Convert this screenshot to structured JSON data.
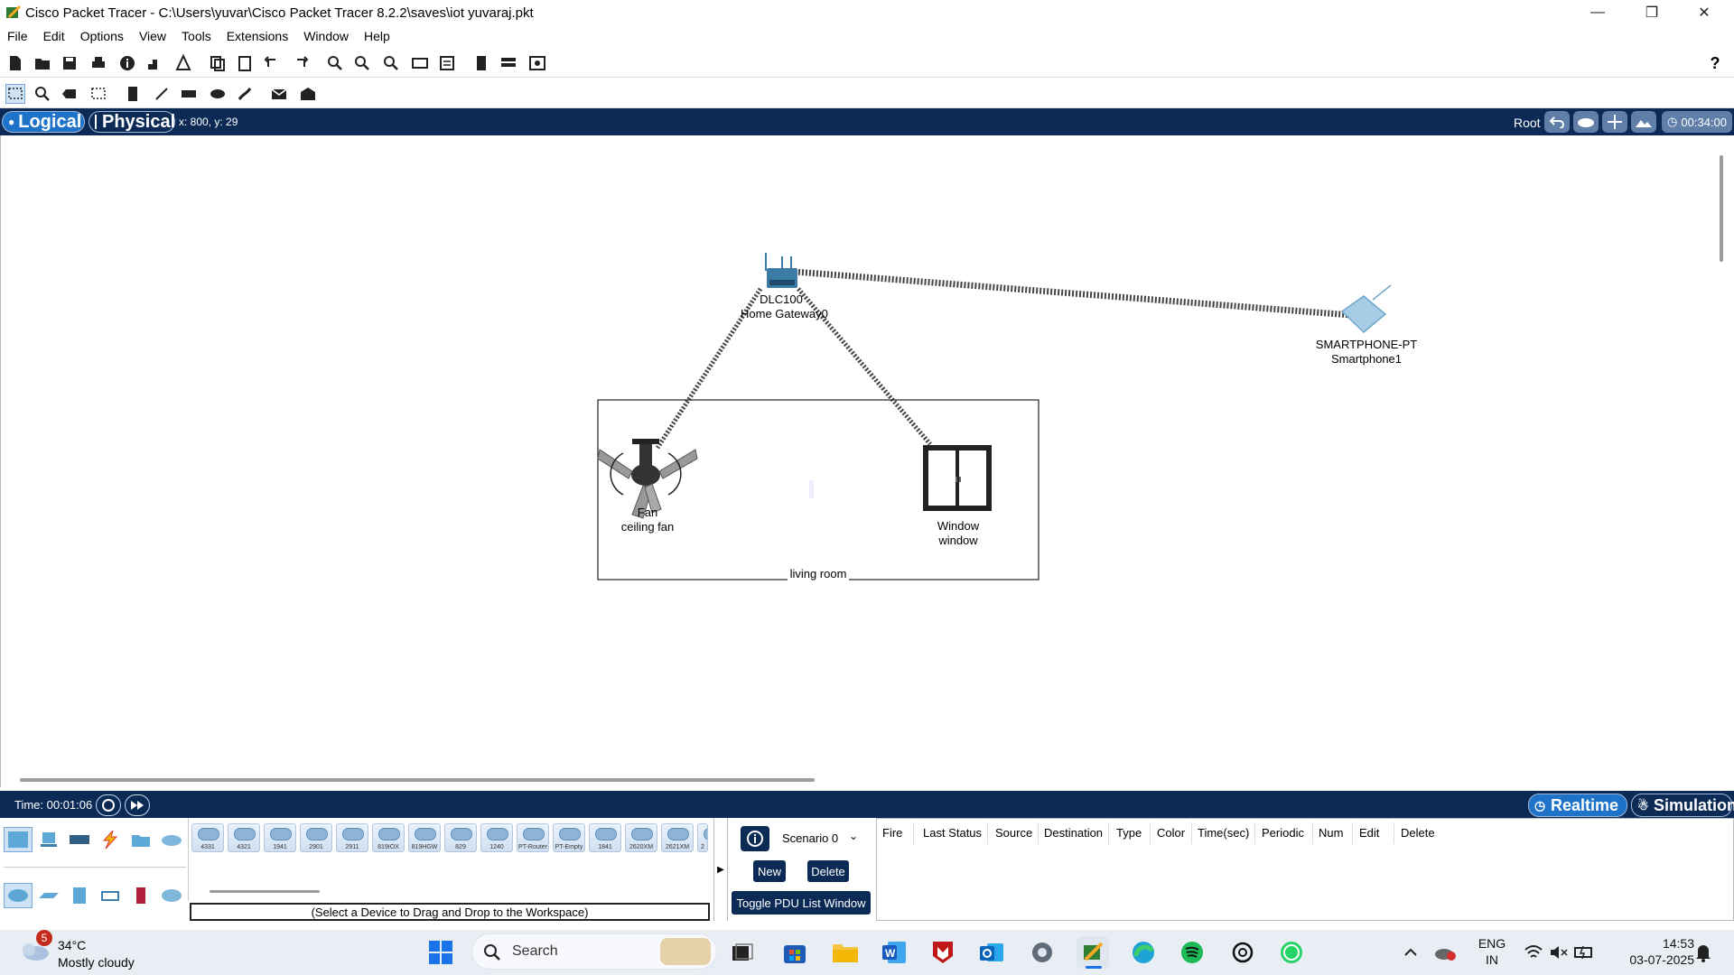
{
  "window": {
    "title": "Cisco Packet Tracer - C:\\Users\\yuvar\\Cisco Packet Tracer 8.2.2\\saves\\iot yuvaraj.pkt",
    "controls": {
      "minimize": "—",
      "restore": "❐",
      "close": "✕"
    }
  },
  "menu": [
    "File",
    "Edit",
    "Options",
    "View",
    "Tools",
    "Extensions",
    "Window",
    "Help"
  ],
  "help_icon": "?",
  "modebar": {
    "logical": "Logical",
    "physical": "Physical",
    "coords": "x: 800, y: 29",
    "root": "Root",
    "clock": "00:34:00"
  },
  "workspace": {
    "devices": {
      "gateway": {
        "model": "DLC100",
        "name": "Home Gateway0"
      },
      "smartphone": {
        "model": "SMARTPHONE-PT",
        "name": "Smartphone1"
      },
      "fan": {
        "model": "Fan",
        "name": "ceiling fan"
      },
      "window": {
        "model": "Window",
        "name": "window"
      }
    },
    "cluster_label": "living room"
  },
  "timebar": {
    "time": "Time: 00:01:06",
    "realtime": "Realtime",
    "simulation": "Simulation"
  },
  "device_list": {
    "items": [
      "4331",
      "4321",
      "1941",
      "2901",
      "2911",
      "819IOX",
      "819HGW",
      "829",
      "1240",
      "PT-Router",
      "PT-Empty",
      "1841",
      "2620XM",
      "2621XM",
      "2"
    ],
    "hint": "(Select a Device to Drag and Drop to the Workspace)"
  },
  "pdu": {
    "scenario": "Scenario 0",
    "new": "New",
    "delete": "Delete",
    "toggle": "Toggle PDU List Window",
    "arrow": "▶"
  },
  "event_columns": [
    "Fire",
    "Last Status",
    "Source",
    "Destination",
    "Type",
    "Color",
    "Time(sec)",
    "Periodic",
    "Num",
    "Edit",
    "Delete"
  ],
  "taskbar": {
    "weather": {
      "badge": "5",
      "temp": "34°C",
      "desc": "Mostly cloudy"
    },
    "search": "Search",
    "lang": {
      "top": "ENG",
      "bottom": "IN"
    },
    "time": "14:53",
    "date": "03-07-2025"
  },
  "colors": {
    "navy": "#0b2a55",
    "accent": "#1e73c8"
  }
}
